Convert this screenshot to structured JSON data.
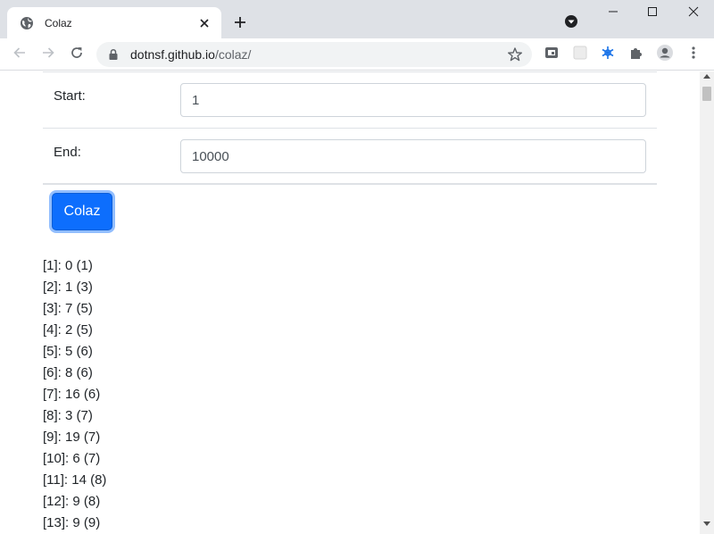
{
  "browser": {
    "tab_title": "Colaz",
    "url_host": "dotnsf.github.io",
    "url_path": "/colaz/"
  },
  "form": {
    "start_label": "Start:",
    "start_value": "1",
    "end_label": "End:",
    "end_value": "10000",
    "button_label": "Colaz"
  },
  "results": [
    "[1]: 0 (1)",
    "[2]: 1 (3)",
    "[3]: 7 (5)",
    "[4]: 2 (5)",
    "[5]: 5 (6)",
    "[6]: 8 (6)",
    "[7]: 16 (6)",
    "[8]: 3 (7)",
    "[9]: 19 (7)",
    "[10]: 6 (7)",
    "[11]: 14 (8)",
    "[12]: 9 (8)",
    "[13]: 9 (9)"
  ],
  "colors": {
    "accent": "#0d6efd",
    "tabstrip": "#dee1e6",
    "extension_blue": "#1a73e8"
  },
  "icons": [
    "globe-icon",
    "close-icon",
    "plus-icon",
    "tab-search-icon",
    "minimize-icon",
    "maximize-icon",
    "window-close-icon",
    "back-icon",
    "forward-icon",
    "reload-icon",
    "lock-icon",
    "star-icon",
    "extension-icon",
    "puzzle-icon",
    "profile-icon",
    "menu-icon"
  ]
}
